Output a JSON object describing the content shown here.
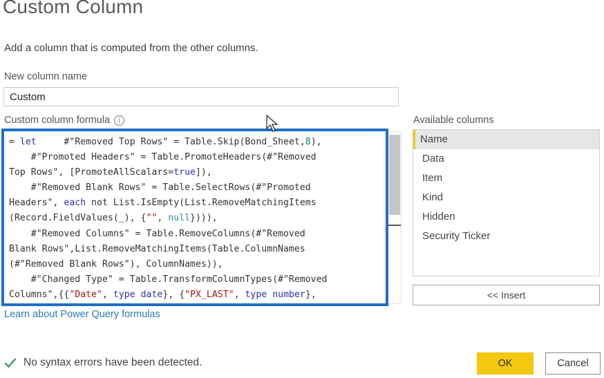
{
  "dialog": {
    "title": "Custom Column",
    "subtitle": "Add a column that is computed from the other columns."
  },
  "new_column": {
    "label": "New column name",
    "value": "Custom"
  },
  "formula": {
    "label": "Custom column formula",
    "info_icon": "info-icon",
    "lines": [
      [
        {
          "t": "= "
        },
        {
          "t": "let",
          "c": "kw"
        },
        {
          "t": "     #"
        },
        {
          "t": "\"Removed Top Rows\""
        },
        {
          "t": " = Table.Skip(Bond_Sheet,"
        },
        {
          "t": "8",
          "c": "num"
        },
        {
          "t": "),"
        }
      ],
      [
        {
          "t": "    #\"Promoted Headers\" = Table.PromoteHeaders(#\"Removed"
        }
      ],
      [
        {
          "t": "Top Rows\", [PromoteAllScalars="
        },
        {
          "t": "true",
          "c": "kw"
        },
        {
          "t": "]),"
        }
      ],
      [
        {
          "t": "    #\"Removed Blank Rows\" = Table.SelectRows(#\"Promoted"
        }
      ],
      [
        {
          "t": "Headers\", "
        },
        {
          "t": "each",
          "c": "kw"
        },
        {
          "t": " not List.IsEmpty(List.RemoveMatchingItems"
        }
      ],
      [
        {
          "t": "(Record.FieldValues(_), {"
        },
        {
          "t": "\"\"",
          "c": "str"
        },
        {
          "t": ", "
        },
        {
          "t": "null",
          "c": "nul"
        },
        {
          "t": "}))),"
        }
      ],
      [
        {
          "t": "    #\"Removed Columns\" = Table.RemoveColumns(#\"Removed"
        }
      ],
      [
        {
          "t": "Blank Rows\",List.RemoveMatchingItems(Table.ColumnNames"
        }
      ],
      [
        {
          "t": "(#\"Removed Blank Rows\"), ColumnNames)),"
        }
      ],
      [
        {
          "t": "    #\"Changed Type\" = Table.TransformColumnTypes(#\"Removed"
        }
      ],
      [
        {
          "t": "Columns\",{{"
        },
        {
          "t": "\"Date\"",
          "c": "str"
        },
        {
          "t": ", "
        },
        {
          "t": "type",
          "c": "kw"
        },
        {
          "t": " "
        },
        {
          "t": "date",
          "c": "kw"
        },
        {
          "t": "}, {"
        },
        {
          "t": "\"PX_LAST\"",
          "c": "str"
        },
        {
          "t": ", "
        },
        {
          "t": "type",
          "c": "kw"
        },
        {
          "t": " "
        },
        {
          "t": "number",
          "c": "kw"
        },
        {
          "t": "},"
        }
      ]
    ]
  },
  "learn_link": "Learn about Power Query formulas",
  "available_columns": {
    "label": "Available columns",
    "items": [
      "Name",
      "Data",
      "Item",
      "Kind",
      "Hidden",
      "Security Ticker"
    ],
    "selected": "Name"
  },
  "insert_button": "<< Insert",
  "status": {
    "icon": "check-icon",
    "text": "No syntax errors have been detected."
  },
  "buttons": {
    "ok": "OK",
    "cancel": "Cancel"
  },
  "colors": {
    "accent_yellow": "#f2c811",
    "highlight_border": "#1f6fc5",
    "link": "#2a7ab8",
    "check": "#3c9a5f"
  }
}
